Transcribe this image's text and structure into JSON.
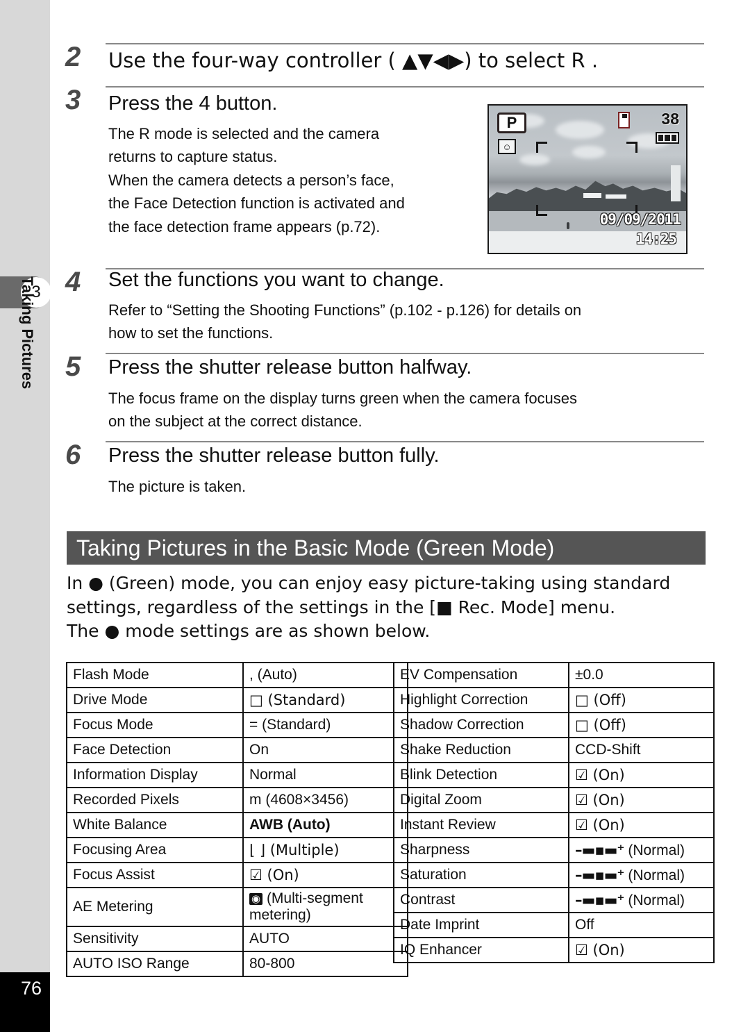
{
  "sidebar": {
    "chapter_number": "3",
    "chapter_title": "Taking Pictures",
    "page_number": "76"
  },
  "steps": [
    {
      "number": "2",
      "heading": "Use the four-way controller (  ▲▼◀▶) to select R .",
      "body": ""
    },
    {
      "number": "3",
      "heading": "Press the  4    button.",
      "body": "The R  mode is selected and the camera returns to capture status.\nWhen the camera detects a person’s face, the Face Detection function is activated and the face detection frame appears (p.72)."
    },
    {
      "number": "4",
      "heading": "Set the functions you want to change.",
      "body": "Refer to “Setting the Shooting Functions” (p.102 - p.126) for details on how to set the functions."
    },
    {
      "number": "5",
      "heading": "Press the shutter release button halfway.",
      "body": "The focus frame on the display turns green when the camera focuses on the subject at the correct distance."
    },
    {
      "number": "6",
      "heading": "Press the shutter release button fully.",
      "body": "The picture is taken."
    }
  ],
  "step3_body_lines": [
    "The R  mode is selected and the camera",
    "returns to capture status.",
    "When the camera detects a person’s face,",
    "the Face Detection function is activated and",
    "the face detection frame appears (p.72)."
  ],
  "step4_body_lines": [
    "Refer to “Setting the Shooting Functions” (p.102 - p.126) for details on",
    "how to set the functions."
  ],
  "step5_body_lines": [
    "The focus frame on the display turns green when the camera focuses",
    "on the subject at the correct distance."
  ],
  "step6_body_lines": [
    "The picture is taken."
  ],
  "lcd": {
    "mode_badge": "P",
    "face_icon": "☺",
    "remaining_shots": "38",
    "date_stamp": "09/09/2011",
    "time_stamp": "14:25"
  },
  "section": {
    "heading": "Taking Pictures in the Basic Mode (Green Mode)",
    "intro_lines": [
      "In ● (Green) mode, you can enjoy easy picture-taking using standard",
      "settings, regardless of the settings in the [■ Rec. Mode] menu.",
      "The ● mode settings are as shown below."
    ]
  },
  "tables": {
    "left": [
      {
        "key": "Flash Mode",
        "value": ",   (Auto)"
      },
      {
        "key": "Drive Mode",
        "value": "□ (Standard)"
      },
      {
        "key": "Focus Mode",
        "value": "=    (Standard)"
      },
      {
        "key": "Face Detection",
        "value": "On"
      },
      {
        "key": "Information Display",
        "value": "Normal"
      },
      {
        "key": "Recorded Pixels",
        "value": "m    (4608×3456)"
      },
      {
        "key": "White Balance",
        "value": "AWB (Auto)"
      },
      {
        "key": "Focusing Area",
        "value": "⌊    ⌋ (Multiple)"
      },
      {
        "key": "Focus Assist",
        "value": "☑  (On)"
      },
      {
        "key": "AE Metering",
        "value": "(Multi-segment metering)"
      },
      {
        "key": "Sensitivity",
        "value": "AUTO"
      },
      {
        "key": "AUTO ISO Range",
        "value": "80-800"
      }
    ],
    "right": [
      {
        "key": "EV Compensation",
        "value": "±0.0"
      },
      {
        "key": "Highlight Correction",
        "value": "□ (Off)"
      },
      {
        "key": "Shadow Correction",
        "value": "□ (Off)"
      },
      {
        "key": "Shake Reduction",
        "value": "CCD-Shift"
      },
      {
        "key": "Blink Detection",
        "value": "☑  (On)"
      },
      {
        "key": "Digital Zoom",
        "value": "☑  (On)"
      },
      {
        "key": "Instant Review",
        "value": "☑  (On)"
      },
      {
        "key": "Sharpness",
        "value": "(Normal)"
      },
      {
        "key": "Saturation",
        "value": "(Normal)"
      },
      {
        "key": "Contrast",
        "value": "(Normal)"
      },
      {
        "key": "Date Imprint",
        "value": "Off"
      },
      {
        "key": "IQ Enhancer",
        "value": "☑  (On)"
      }
    ]
  }
}
